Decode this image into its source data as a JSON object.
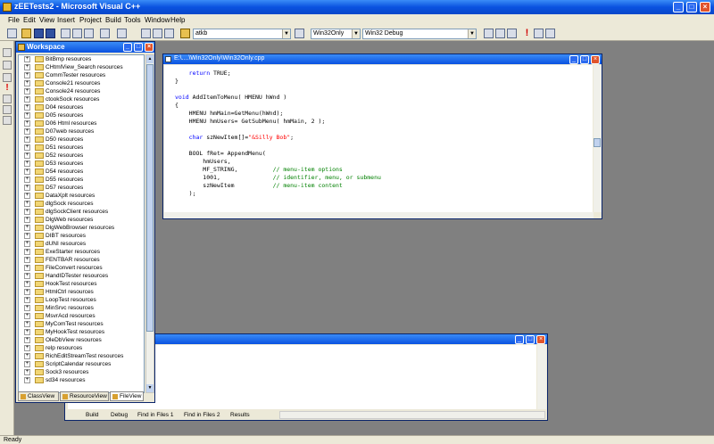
{
  "window": {
    "title": "zEETests2 - Microsoft Visual C++"
  },
  "menu": [
    "File",
    "Edit",
    "View",
    "Insert",
    "Project",
    "Build",
    "Tools",
    "Window",
    "Help"
  ],
  "toolbar": {
    "find_combo": "atkb",
    "config_combo": "Win32Only",
    "build_combo": "Win32 Debug"
  },
  "workspace": {
    "title": "Workspace",
    "items": [
      "BitBmp resources",
      "CHtmlView_Search resources",
      "CommTester resources",
      "Console21 resources",
      "Console24 resources",
      "ctookSock resources",
      "D04 resources",
      "D05 resources",
      "D06 Html resources",
      "D07web resources",
      "D50 resources",
      "D51 resources",
      "D52 resources",
      "D53 resources",
      "D54 resources",
      "D55 resources",
      "D57 resources",
      "DataXplt resources",
      "dlgSock resources",
      "dlgSockClient resources",
      "DlgWeb resources",
      "DlgWebBrowser resources",
      "DIBT resources",
      "dUNI resources",
      "ExeStarter resources",
      "FENTBAR resources",
      "FileConvert resources",
      "HandIDTester resources",
      "HookTest resources",
      "HtmlCtrl resources",
      "LoopTest resources",
      "MinSrvc resources",
      "MsvrAcd resources",
      "MyComTest resources",
      "MyHookTest resources",
      "OleDbView resources",
      "relp resources",
      "RichEditStreamTest resources",
      "ScriptCalendar resources",
      "Sock3 resources",
      "sd34 resources"
    ],
    "tabs": [
      "ClassView",
      "ResourceView",
      "FileView"
    ]
  },
  "editor": {
    "title": "E:\\....\\Win32Only\\Win32Only.cpp",
    "code": [
      {
        "parts": [
          [
            "",
            "    "
          ],
          [
            "kw",
            "return"
          ],
          [
            "",
            " TRUE;"
          ]
        ]
      },
      {
        "parts": [
          [
            "",
            "}"
          ]
        ]
      },
      {
        "parts": [
          [
            "",
            ""
          ]
        ]
      },
      {
        "parts": [
          [
            "kw",
            "void"
          ],
          [
            "",
            " AddItemToMenu( HMENU hWnd )"
          ]
        ]
      },
      {
        "parts": [
          [
            "",
            "{"
          ]
        ]
      },
      {
        "parts": [
          [
            "",
            "    HMENU hmMain=GetMenu(hWnd);"
          ]
        ]
      },
      {
        "parts": [
          [
            "",
            "    HMENU hmUsers= GetSubMenu( hmMain, 2 );"
          ]
        ]
      },
      {
        "parts": [
          [
            "",
            ""
          ]
        ]
      },
      {
        "parts": [
          [
            "",
            "    "
          ],
          [
            "kw",
            "char"
          ],
          [
            "",
            " szNewItem[]="
          ],
          [
            "st",
            "\"&Silly Bob\""
          ],
          [
            "",
            ";"
          ]
        ]
      },
      {
        "parts": [
          [
            "",
            ""
          ]
        ]
      },
      {
        "parts": [
          [
            "",
            "    BOOL fRet= AppendMenu("
          ]
        ]
      },
      {
        "parts": [
          [
            "",
            "        hmUsers,"
          ]
        ]
      },
      {
        "parts": [
          [
            "",
            "        MF_STRING,          "
          ],
          [
            "cm",
            "// menu-item options"
          ]
        ]
      },
      {
        "parts": [
          [
            "",
            "        1001,               "
          ],
          [
            "cm",
            "// identifier, menu, or submenu"
          ]
        ]
      },
      {
        "parts": [
          [
            "",
            "        szNewItem           "
          ],
          [
            "cm",
            "// menu-item content"
          ]
        ]
      },
      {
        "parts": [
          [
            "",
            "    );"
          ]
        ]
      }
    ]
  },
  "output": {
    "tabs": [
      "Build",
      "Debug",
      "Find in Files 1",
      "Find in Files 2",
      "Results"
    ]
  },
  "status": {
    "text": "Ready"
  }
}
